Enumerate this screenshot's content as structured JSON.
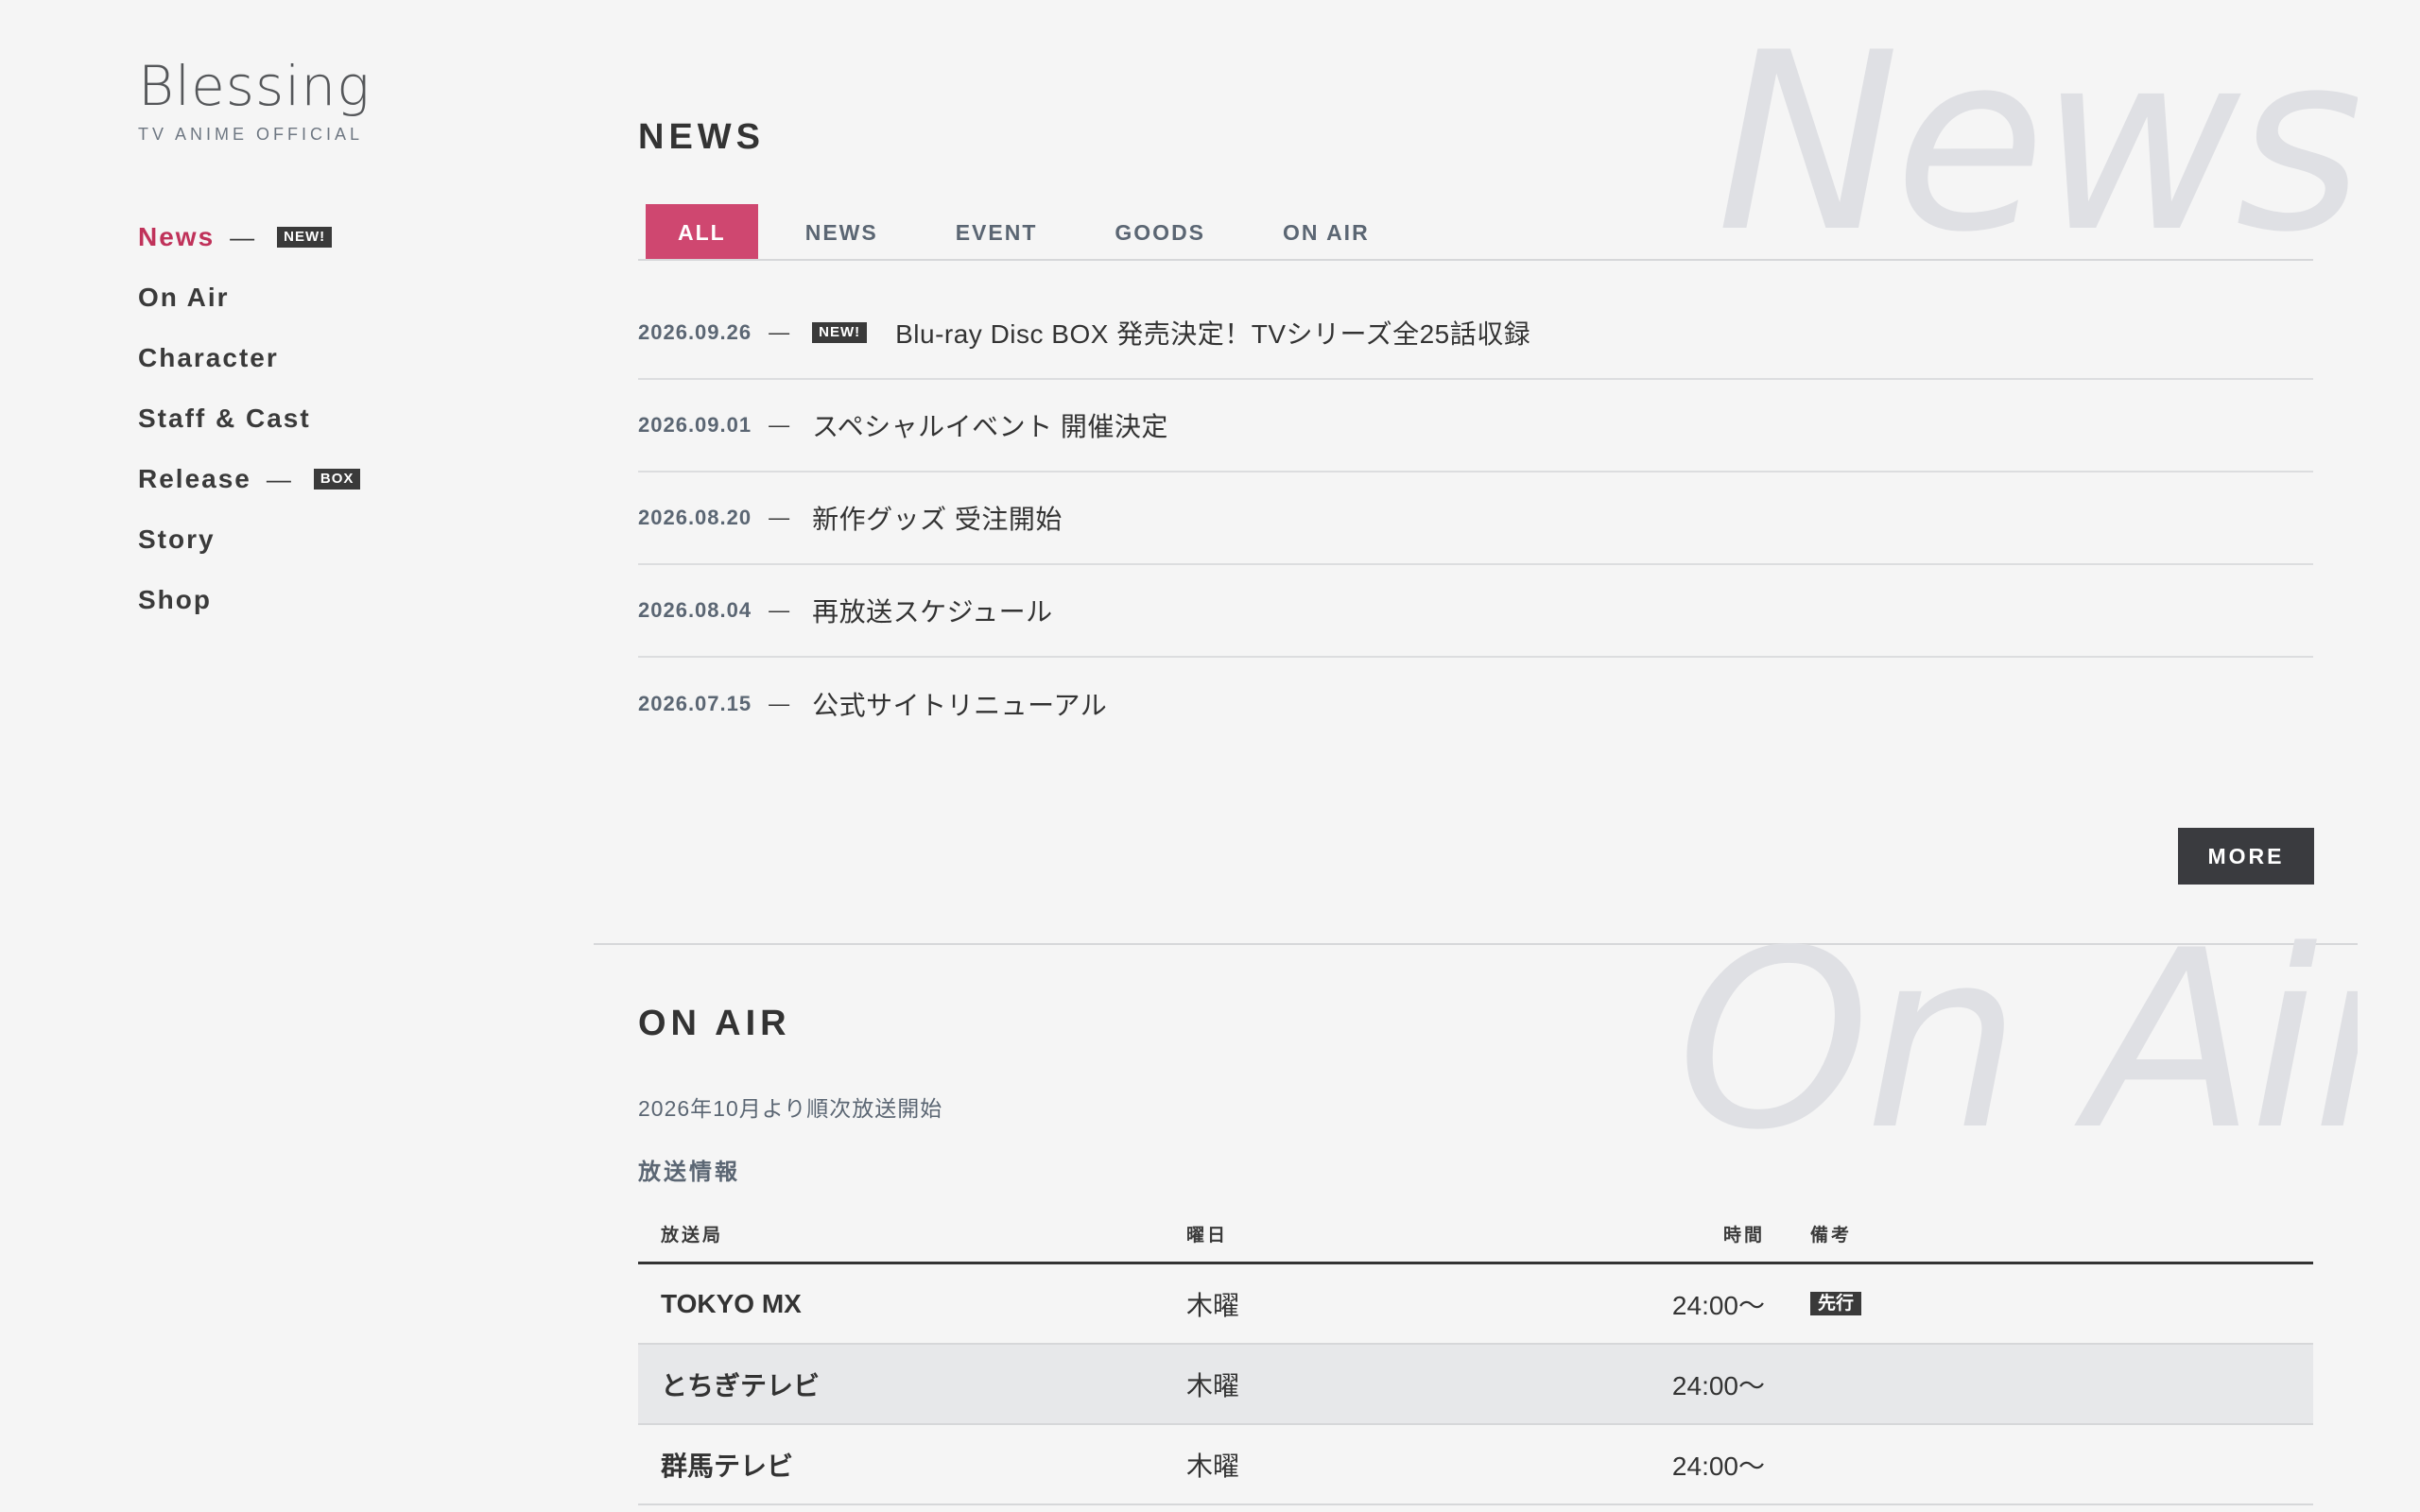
{
  "brand": {
    "title": "Blessing",
    "subtitle": "TV ANIME OFFICIAL"
  },
  "nav": {
    "items": [
      {
        "label": "News",
        "badge": "NEW!"
      },
      {
        "label": "On Air"
      },
      {
        "label": "Character"
      },
      {
        "label": "Staff & Cast"
      },
      {
        "label": "Release",
        "badge": "BOX"
      },
      {
        "label": "Story"
      },
      {
        "label": "Shop"
      }
    ],
    "dash": "—"
  },
  "news": {
    "watermark": "News",
    "title": "NEWS",
    "tabs": [
      "ALL",
      "NEWS",
      "EVENT",
      "GOODS",
      "ON AIR"
    ],
    "active_tab": "ALL",
    "dash": "—",
    "items": [
      {
        "date": "2026.09.26",
        "badge": "NEW!",
        "title": "Blu-ray Disc BOX 発売決定！TVシリーズ全25話収録"
      },
      {
        "date": "2026.09.01",
        "title": "スペシャルイベント 開催決定"
      },
      {
        "date": "2026.08.20",
        "title": "新作グッズ 受注開始"
      },
      {
        "date": "2026.08.04",
        "title": "再放送スケジュール"
      },
      {
        "date": "2026.07.15",
        "title": "公式サイトリニューアル"
      }
    ],
    "more_label": "MORE"
  },
  "onair": {
    "watermark": "On Air",
    "title": "ON AIR",
    "lead": "2026年10月より順次放送開始",
    "subheading": "放送情報",
    "columns": [
      "放送局",
      "曜日",
      "時間",
      "備考"
    ],
    "rows": [
      {
        "station": "TOKYO MX",
        "day": "木曜",
        "time": "24:00〜",
        "note": "先行"
      },
      {
        "station": "とちぎテレビ",
        "day": "木曜",
        "time": "24:00〜",
        "note": ""
      },
      {
        "station": "群馬テレビ",
        "day": "木曜",
        "time": "24:00〜",
        "note": ""
      }
    ]
  },
  "colors": {
    "accent": "#cf4770",
    "nav_active": "#c0325a",
    "dark": "#3a3b3f",
    "background": "#f5f5f5",
    "watermark": "#dfe0e4"
  }
}
